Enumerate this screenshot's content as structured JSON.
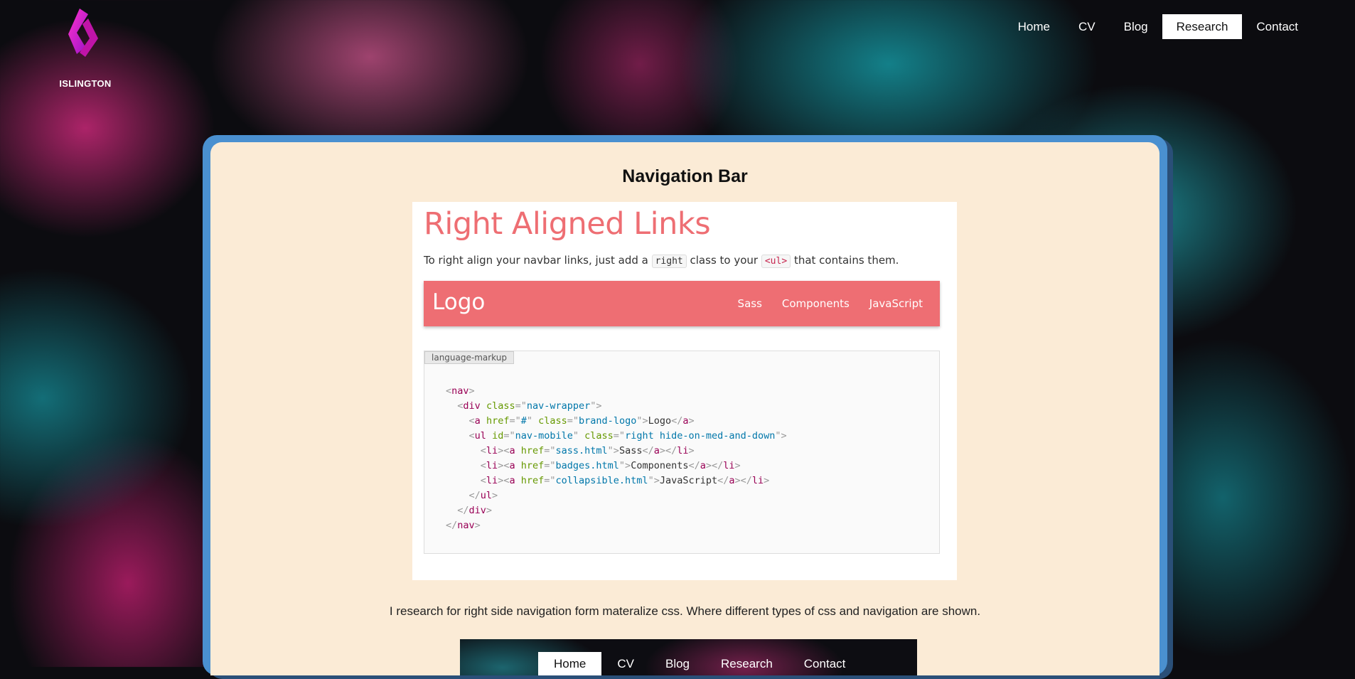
{
  "brand": {
    "name": "ISLINGTON",
    "icon": "islington-logo-icon"
  },
  "nav": [
    {
      "label": "Home",
      "active": false
    },
    {
      "label": "CV",
      "active": false
    },
    {
      "label": "Blog",
      "active": false
    },
    {
      "label": "Research",
      "active": true
    },
    {
      "label": "Contact",
      "active": false
    }
  ],
  "section": {
    "title": "Navigation Bar"
  },
  "doc": {
    "heading": "Right Aligned Links",
    "desc_before": "To right align your navbar links, just add a ",
    "code1": "right",
    "desc_mid": " class to your ",
    "code2": "<ul>",
    "desc_after": " that contains them.",
    "demo_brand": "Logo",
    "demo_links": [
      "Sass",
      "Components",
      "JavaScript"
    ],
    "code_label": "language-markup"
  },
  "caption": "I research for right side navigation form materalize css. Where different types of css and navigation are shown.",
  "preview_nav": [
    "Home",
    "CV",
    "Blog",
    "Research",
    "Contact"
  ],
  "colors": {
    "accent": "#ee6e73",
    "card_border": "#4a90d0",
    "card_bg": "#fbebd6"
  }
}
